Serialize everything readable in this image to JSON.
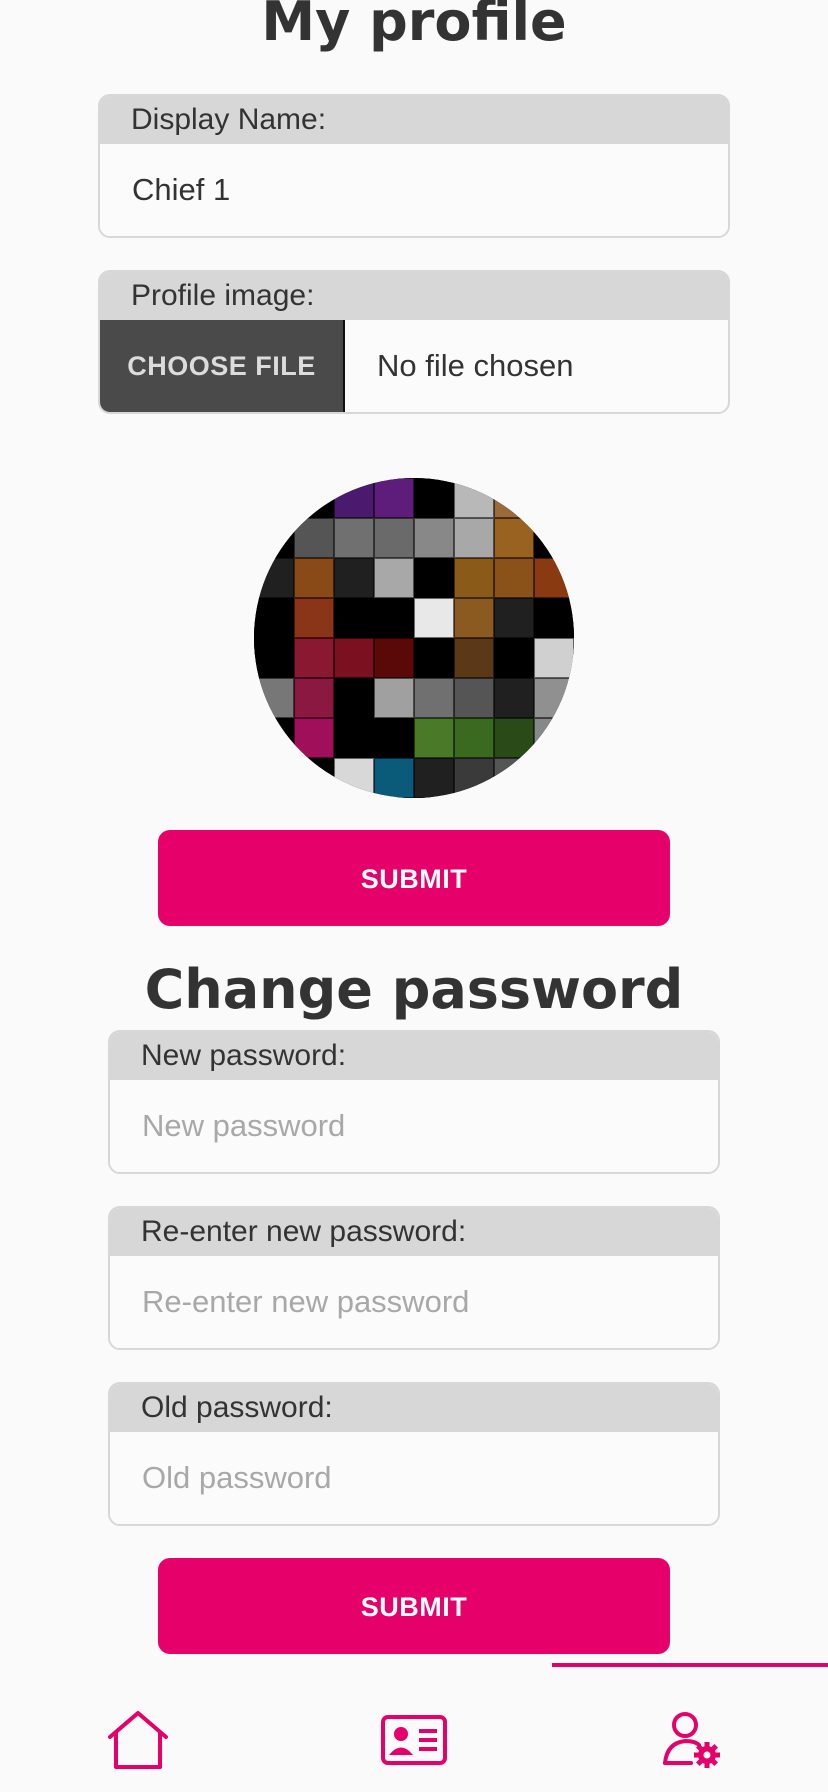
{
  "profile": {
    "title": "My profile",
    "display_name": {
      "label": "Display Name:",
      "value": "Chief 1"
    },
    "profile_image": {
      "label": "Profile image:",
      "button": "CHOOSE FILE",
      "status": "No file chosen"
    },
    "submit": "SUBMIT"
  },
  "password": {
    "title": "Change password",
    "new": {
      "label": "New password:",
      "placeholder": "New password"
    },
    "reenter": {
      "label": "Re-enter new password:",
      "placeholder": "Re-enter new password"
    },
    "old": {
      "label": "Old password:",
      "placeholder": "Old password"
    },
    "submit": "SUBMIT"
  },
  "nav": {
    "items": [
      {
        "name": "home",
        "icon": "home-icon"
      },
      {
        "name": "profile-card",
        "icon": "id-card-icon"
      },
      {
        "name": "user-settings",
        "icon": "user-settings-icon",
        "active": true
      }
    ]
  },
  "colors": {
    "accent": "#e5006a",
    "label_bg": "#d7d7d7",
    "choose_bg": "#4a4a4a"
  },
  "avatar_tiles": [
    "#000",
    "#000",
    "#4a1a6e",
    "#5e1d7a",
    "#000",
    "#b8b8b8",
    "#9a6a3a",
    "#000",
    "#000",
    "#555",
    "#707070",
    "#6a6a6a",
    "#888",
    "#a8a8a8",
    "#9a6220",
    "#000",
    "#202020",
    "#8a4a18",
    "#202020",
    "#a8a8a8",
    "#000",
    "#8a5a18",
    "#8a5218",
    "#8a3a10",
    "#000",
    "#8a3418",
    "#000",
    "#000",
    "#e8e8e8",
    "#8a5a20",
    "#202020",
    "#000",
    "#000",
    "#8a1830",
    "#7a1020",
    "#5a0808",
    "#000",
    "#5a3818",
    "#000",
    "#d0d0d0",
    "#777",
    "#8a1840",
    "#000",
    "#a0a0a0",
    "#707070",
    "#555",
    "#202020",
    "#909090",
    "#000",
    "#a0105a",
    "#000",
    "#000",
    "#4a7a28",
    "#3a6a20",
    "#2a4a18",
    "#888",
    "#202020",
    "#000",
    "#d8d8d8",
    "#0a5a7a",
    "#202020",
    "#3a3a3a",
    "#555",
    "#777"
  ]
}
